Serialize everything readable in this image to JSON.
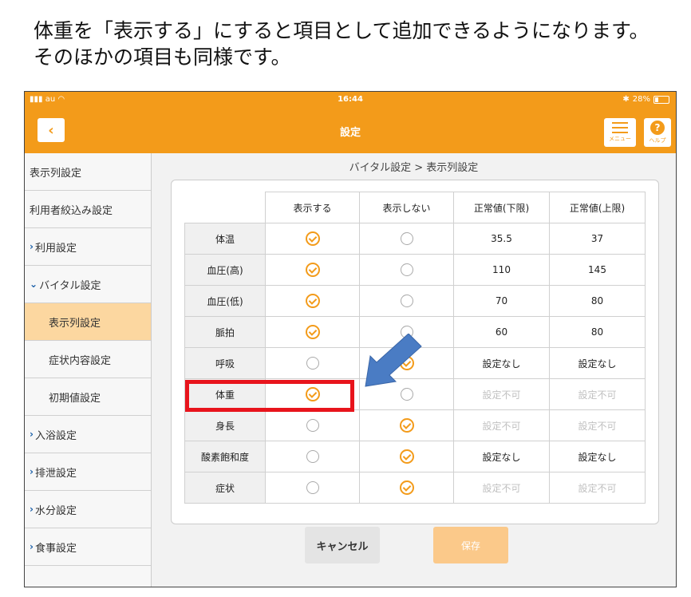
{
  "caption": {
    "line1": "体重を「表示する」にすると項目として追加できるようになります。",
    "line2": "そのほかの項目も同様です。"
  },
  "status_bar": {
    "carrier": "au",
    "time": "16:44",
    "battery": "28%"
  },
  "nav": {
    "title": "設定",
    "back_icon": "chevron-left",
    "menu_label": "メニュー",
    "help_label": "ヘルプ",
    "help_symbol": "?"
  },
  "sidebar": {
    "items": [
      {
        "label": "表示列設定",
        "type": "plain"
      },
      {
        "label": "利用者絞込み設定",
        "type": "plain"
      },
      {
        "label": "利用設定",
        "type": "collapsed"
      },
      {
        "label": "バイタル設定",
        "type": "expanded"
      },
      {
        "label": "表示列設定",
        "type": "sub-active"
      },
      {
        "label": "症状内容設定",
        "type": "sub"
      },
      {
        "label": "初期値設定",
        "type": "sub"
      },
      {
        "label": "入浴設定",
        "type": "collapsed"
      },
      {
        "label": "排泄設定",
        "type": "collapsed"
      },
      {
        "label": "水分設定",
        "type": "collapsed"
      },
      {
        "label": "食事設定",
        "type": "collapsed"
      }
    ]
  },
  "breadcrumb": "バイタル設定 > 表示列設定",
  "table": {
    "headers": [
      "表示する",
      "表示しない",
      "正常値(下限)",
      "正常値(上限)"
    ],
    "rows": [
      {
        "name": "体温",
        "display": true,
        "lower": "35.5",
        "upper": "37",
        "editable": true
      },
      {
        "name": "血圧(高)",
        "display": true,
        "lower": "110",
        "upper": "145",
        "editable": true
      },
      {
        "name": "血圧(低)",
        "display": true,
        "lower": "70",
        "upper": "80",
        "editable": true
      },
      {
        "name": "脈拍",
        "display": true,
        "lower": "60",
        "upper": "80",
        "editable": true
      },
      {
        "name": "呼吸",
        "display": false,
        "lower": "設定なし",
        "upper": "設定なし",
        "editable": true
      },
      {
        "name": "体重",
        "display": true,
        "lower": "設定不可",
        "upper": "設定不可",
        "editable": false
      },
      {
        "name": "身長",
        "display": false,
        "lower": "設定不可",
        "upper": "設定不可",
        "editable": false
      },
      {
        "name": "酸素飽和度",
        "display": false,
        "lower": "設定なし",
        "upper": "設定なし",
        "editable": true
      },
      {
        "name": "症状",
        "display": false,
        "lower": "設定不可",
        "upper": "設定不可",
        "editable": false
      }
    ]
  },
  "buttons": {
    "cancel": "キャンセル",
    "save": "保存"
  },
  "colors": {
    "accent": "#f39b1a",
    "highlight": "#e8141c",
    "arrow": "#4a7cc4"
  }
}
